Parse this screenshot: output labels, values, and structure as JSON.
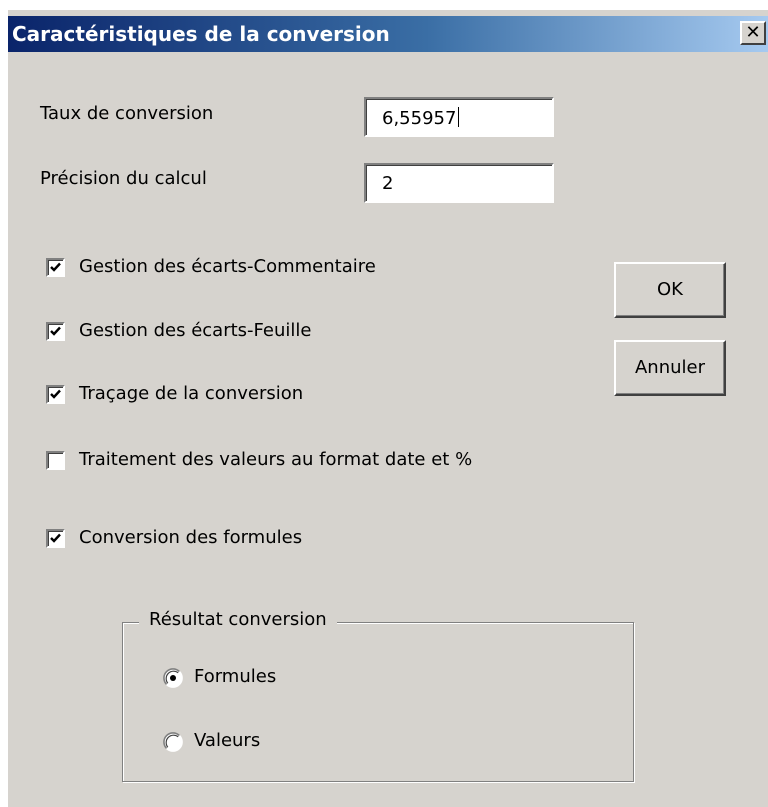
{
  "window": {
    "title": "Caractéristiques de la conversion",
    "close_glyph": "✕"
  },
  "fields": {
    "rate_label": "Taux de conversion",
    "rate_value": "6,55957",
    "precision_label": "Précision du calcul",
    "precision_value": "2"
  },
  "options": [
    {
      "label": "Gestion des écarts-Commentaire",
      "checked": true
    },
    {
      "label": "Gestion des écarts-Feuille",
      "checked": true
    },
    {
      "label": "Traçage de la conversion",
      "checked": true
    },
    {
      "label": "Traitement des valeurs au format date et %",
      "checked": false
    },
    {
      "label": "Conversion des formules",
      "checked": true
    }
  ],
  "buttons": {
    "ok": "OK",
    "cancel": "Annuler"
  },
  "result_group": {
    "legend": "Résultat conversion",
    "radios": [
      {
        "label": "Formules",
        "selected": true
      },
      {
        "label": "Valeurs",
        "selected": false
      }
    ]
  },
  "icons": {
    "checkmark": "check-icon",
    "close": "close-icon",
    "radio": "radio-icon"
  }
}
